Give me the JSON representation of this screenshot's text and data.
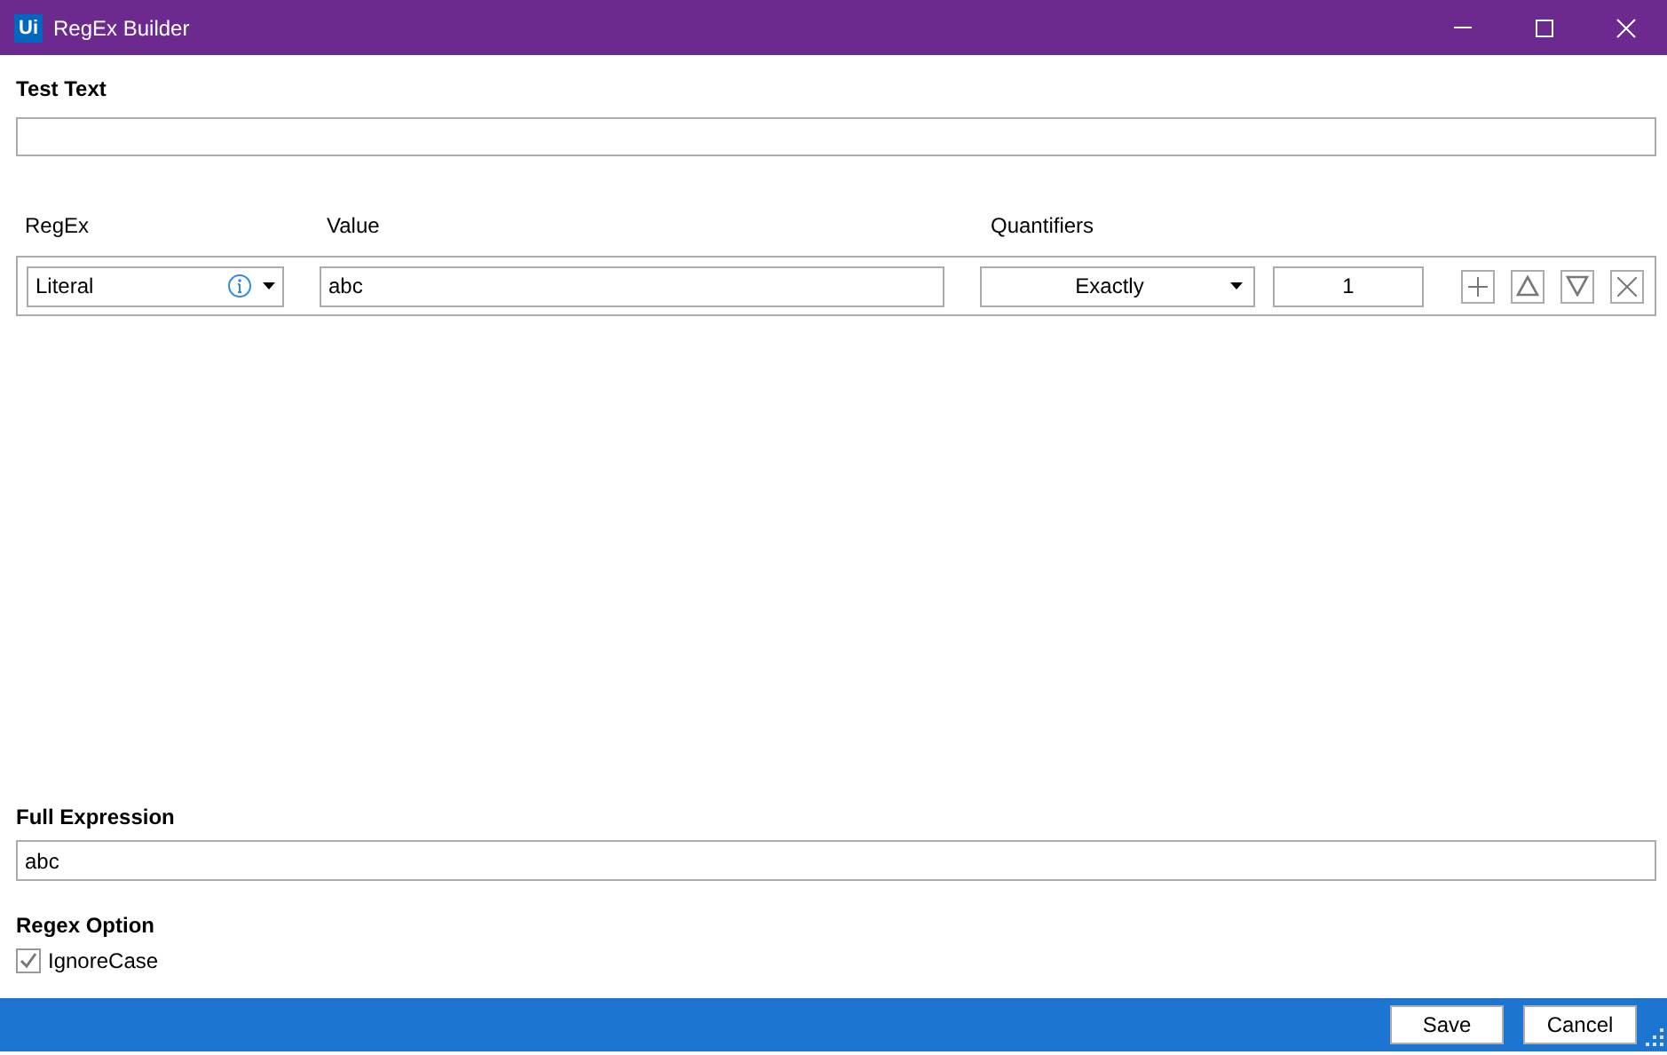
{
  "window": {
    "title": "RegEx Builder",
    "logo": "Ui"
  },
  "test_text": {
    "label": "Test Text"
  },
  "columns": [
    "RegEx",
    "Value",
    "Quantifiers"
  ],
  "rows": [
    {
      "type": "Literal",
      "value": "abc",
      "quantifier": "Exactly",
      "count": "1"
    }
  ],
  "full_expression": {
    "label": "Full Expression",
    "value": "abc"
  },
  "regex_option": {
    "label": "Regex Option",
    "options": [
      {
        "label": "IgnoreCase",
        "checked": true
      }
    ]
  },
  "buttons": [
    "Save",
    "Cancel"
  ]
}
